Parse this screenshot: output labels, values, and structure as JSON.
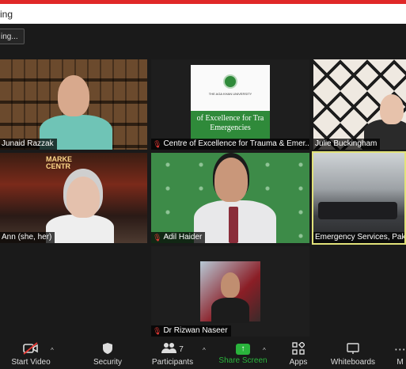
{
  "window": {
    "title_fragment": "ing",
    "accent_color": "#e02828"
  },
  "topbar": {
    "view_button_label": "ing..."
  },
  "participants": [
    {
      "name": "Junaid Razzak",
      "muted": false,
      "background": "bookshelf"
    },
    {
      "name": "Centre of Excellence for Trauma & Emer...",
      "muted": true,
      "background": "certificate",
      "certificate_institution": "THE AGA KHAN UNIVERSITY",
      "certificate_text": "of Excellence for Tra\nEmergencies"
    },
    {
      "name": "Julie Buckingham",
      "muted": false,
      "background": "white-shelf"
    },
    {
      "name": "Ann (she, her)",
      "muted": false,
      "background": "street",
      "sign_text": "MARKE\nCENTR"
    },
    {
      "name": "Adil Haider",
      "muted": true,
      "background": "green-wall",
      "active_speaker": false
    },
    {
      "name": "Emergency Services, Pakis",
      "muted": false,
      "background": "room",
      "active_speaker": true
    },
    {
      "name": "Dr Rizwan Naseer",
      "muted": true,
      "background": "photo"
    }
  ],
  "toolbar": {
    "start_video": {
      "label": "Start Video",
      "icon": "video-off-icon"
    },
    "security": {
      "label": "Security",
      "icon": "shield-icon"
    },
    "participants": {
      "label": "Participants",
      "icon": "people-icon",
      "count": "7"
    },
    "share_screen": {
      "label": "Share Screen",
      "icon": "share-screen-icon",
      "color": "#2ab43c"
    },
    "apps": {
      "label": "Apps",
      "icon": "apps-icon"
    },
    "whiteboards": {
      "label": "Whiteboards",
      "icon": "whiteboard-icon"
    },
    "more": {
      "label": "M",
      "icon": "more-icon"
    }
  }
}
